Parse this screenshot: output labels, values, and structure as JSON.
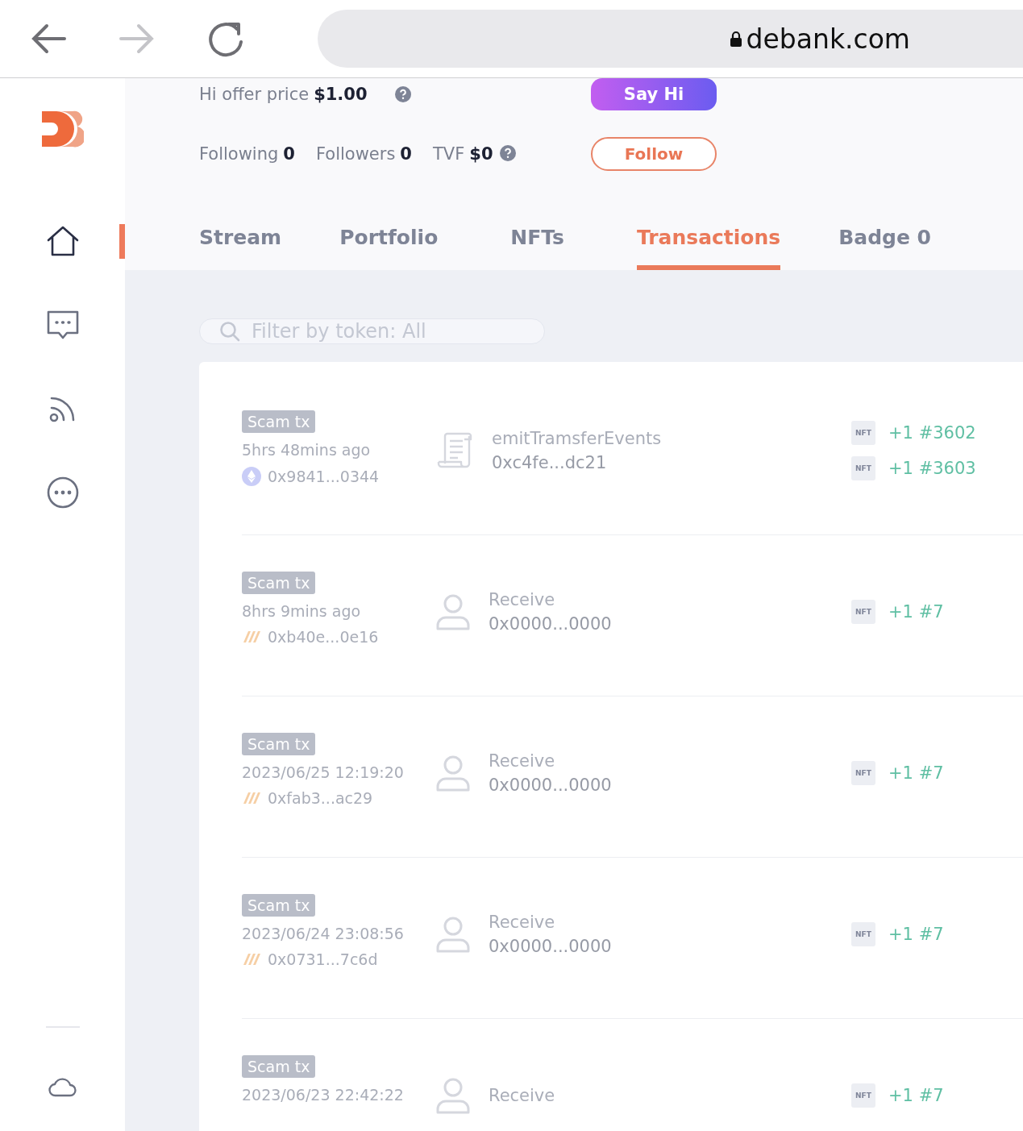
{
  "browser": {
    "url": "debank.com"
  },
  "sidebar": {
    "items": [
      {
        "kind": "home",
        "selected": true
      },
      {
        "kind": "chat",
        "selected": false
      },
      {
        "kind": "feed",
        "selected": false
      },
      {
        "kind": "more",
        "selected": false
      }
    ]
  },
  "profile": {
    "offer_label": "Hi offer price",
    "offer_value": "$1.00",
    "say_hi": "Say Hi",
    "stats": [
      {
        "label": "Following",
        "value": "0",
        "help": false
      },
      {
        "label": "Followers",
        "value": "0",
        "help": false
      },
      {
        "label": "TVF",
        "value": "$0",
        "help": true
      }
    ],
    "follow": "Follow"
  },
  "tabs": [
    {
      "label": "Stream",
      "selected": false
    },
    {
      "label": "Portfolio",
      "selected": false
    },
    {
      "label": "NFTs",
      "selected": false
    },
    {
      "label": "Transactions",
      "selected": true
    },
    {
      "label": "Badge 0",
      "selected": false
    }
  ],
  "filter": {
    "placeholder": "Filter by token: All"
  },
  "transactions": [
    {
      "tag": "Scam tx",
      "time": "5hrs 48mins ago",
      "address": {
        "kind": "eth",
        "text": "0x9841...0344"
      },
      "kind": "contract",
      "action": "emitTramsferEvents",
      "counterparty": "0xc4fe...dc21",
      "tokens": [
        {
          "badge": "NFT",
          "amount": "+1 #3602"
        },
        {
          "badge": "NFT",
          "amount": "+1 #3603"
        }
      ]
    },
    {
      "tag": "Scam tx",
      "time": "8hrs 9mins ago",
      "address": {
        "kind": "stripes",
        "text": "0xb40e...0e16"
      },
      "kind": "person",
      "action": "Receive",
      "counterparty": "0x0000...0000",
      "tokens": [
        {
          "badge": "NFT",
          "amount": "+1 #7"
        }
      ]
    },
    {
      "tag": "Scam tx",
      "time": "2023/06/25 12:19:20",
      "address": {
        "kind": "stripes",
        "text": "0xfab3...ac29"
      },
      "kind": "person",
      "action": "Receive",
      "counterparty": "0x0000...0000",
      "tokens": [
        {
          "badge": "NFT",
          "amount": "+1 #7"
        }
      ]
    },
    {
      "tag": "Scam tx",
      "time": "2023/06/24 23:08:56",
      "address": {
        "kind": "stripes",
        "text": "0x0731...7c6d"
      },
      "kind": "person",
      "action": "Receive",
      "counterparty": "0x0000...0000",
      "tokens": [
        {
          "badge": "NFT",
          "amount": "+1 #7"
        }
      ]
    },
    {
      "tag": "Scam tx",
      "time": "2023/06/23 22:42:22",
      "kind": "person",
      "action": "Receive",
      "tokens": [
        {
          "badge": "NFT",
          "amount": "+1 #7"
        }
      ]
    }
  ]
}
